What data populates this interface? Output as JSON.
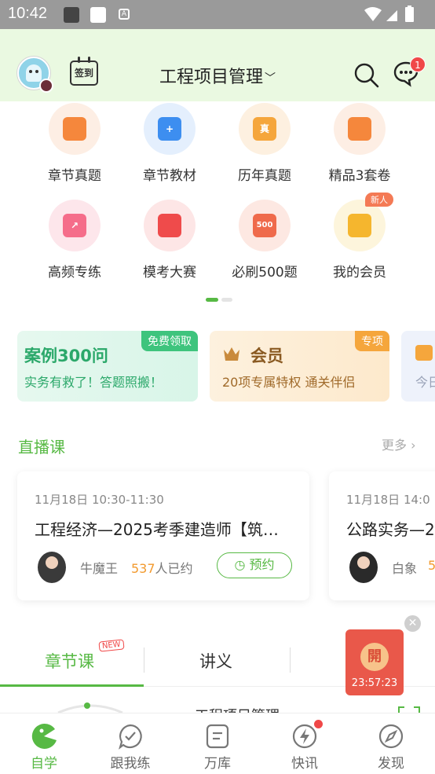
{
  "status_bar": {
    "time": "10:42",
    "notif_badge": "A"
  },
  "header": {
    "checkin_label": "签到",
    "title": "工程项目管理",
    "message_count": "1"
  },
  "grid": [
    {
      "label": "章节真题",
      "icon": "chapter-exam-icon",
      "color": "#f5873c",
      "bg": "#fdeee4",
      "glyph": ""
    },
    {
      "label": "章节教材",
      "icon": "textbook-icon",
      "color": "#3d8ef0",
      "bg": "#e4effd",
      "glyph": "+"
    },
    {
      "label": "历年真题",
      "icon": "past-exam-icon",
      "color": "#f5a63c",
      "bg": "#fdf0e0",
      "glyph": "真"
    },
    {
      "label": "精品3套卷",
      "icon": "paper-set-icon",
      "color": "#f5873c",
      "bg": "#fdeee4",
      "glyph": ""
    },
    {
      "label": "高频专练",
      "icon": "high-frequency-icon",
      "color": "#f56d8a",
      "bg": "#fde6eb",
      "glyph": "↗"
    },
    {
      "label": "模考大赛",
      "icon": "mock-contest-icon",
      "color": "#ef4b4b",
      "bg": "#fde6e6",
      "glyph": ""
    },
    {
      "label": "必刷500题",
      "icon": "must-do-500-icon",
      "color": "#ef6a4b",
      "bg": "#fde8e2",
      "glyph": "500"
    },
    {
      "label": "我的会员",
      "icon": "crown-icon",
      "color": "#f5b62e",
      "bg": "#fdf5dc",
      "glyph": ""
    }
  ],
  "new_tag": "新人",
  "promos": [
    {
      "title": "案例300问",
      "sub": "实务有救了！答题照搬！",
      "tag": "免费领取"
    },
    {
      "title": "会员",
      "sub": "20项专属特权  通关伴侣",
      "tag": "专项"
    },
    {
      "title": "",
      "sub": "今日"
    }
  ],
  "live": {
    "section_title": "直播课",
    "more": "更多",
    "cards": [
      {
        "time": "11月18日 10:30-11:30",
        "title": "工程经济—2025考季建造师【筑…",
        "teacher": "牛魔王",
        "count": "537",
        "count_suffix": "人已约",
        "action": "预约"
      },
      {
        "time": "11月18日 14:0",
        "title": "公路实务—2",
        "teacher": "白象",
        "count": "5"
      }
    ]
  },
  "tabs": {
    "items": [
      "章节课",
      "讲义"
    ],
    "new_badge": "NEW"
  },
  "floating": {
    "seal": "開",
    "countdown": "23:57:23"
  },
  "peek": {
    "title": "工程项目管理"
  },
  "bottom_nav": [
    {
      "label": "自学",
      "icon": "self-study-icon"
    },
    {
      "label": "跟我练",
      "icon": "practice-icon"
    },
    {
      "label": "万库",
      "icon": "library-icon"
    },
    {
      "label": "快讯",
      "icon": "news-flash-icon"
    },
    {
      "label": "发现",
      "icon": "compass-icon"
    }
  ],
  "colors": {
    "accent": "#57b944",
    "header_bg": "#eaf9e1",
    "badge": "#f04848",
    "orange": "#f29a2e"
  }
}
